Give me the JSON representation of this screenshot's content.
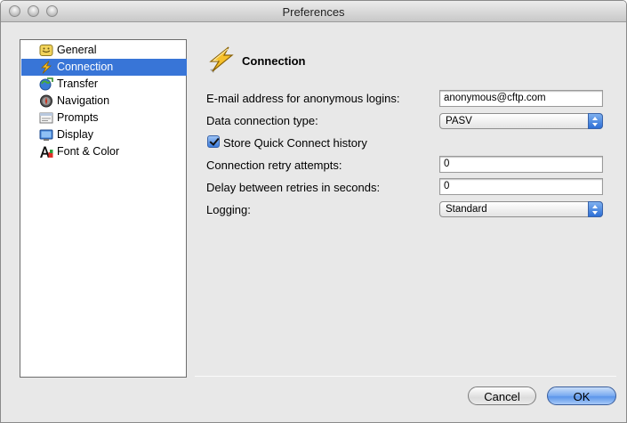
{
  "window": {
    "title": "Preferences"
  },
  "sidebar": {
    "items": [
      {
        "label": "General",
        "icon": "general-icon",
        "selected": false
      },
      {
        "label": "Connection",
        "icon": "connection-icon",
        "selected": true
      },
      {
        "label": "Transfer",
        "icon": "transfer-icon",
        "selected": false
      },
      {
        "label": "Navigation",
        "icon": "navigation-icon",
        "selected": false
      },
      {
        "label": "Prompts",
        "icon": "prompts-icon",
        "selected": false
      },
      {
        "label": "Display",
        "icon": "display-icon",
        "selected": false
      },
      {
        "label": "Font & Color",
        "icon": "font-color-icon",
        "selected": false
      }
    ]
  },
  "panel": {
    "title": "Connection",
    "email": {
      "label": "E-mail address for anonymous logins:",
      "value": "anonymous@cftp.com"
    },
    "data_type": {
      "label": "Data connection type:",
      "value": "PASV"
    },
    "quick_connect": {
      "label": "Store Quick Connect history",
      "checked": true
    },
    "retry": {
      "label": "Connection retry attempts:",
      "value": "0"
    },
    "delay": {
      "label": "Delay between retries in seconds:",
      "value": "0"
    },
    "logging": {
      "label": "Logging:",
      "value": "Standard"
    }
  },
  "buttons": {
    "cancel": "Cancel",
    "ok": "OK"
  },
  "colors": {
    "selection": "#3875d7",
    "default_button": "#5b95ea"
  }
}
